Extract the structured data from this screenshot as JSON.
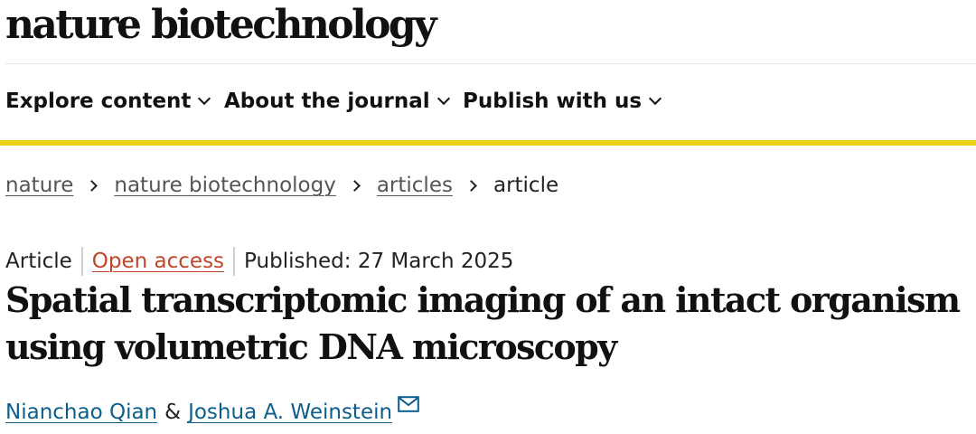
{
  "header": {
    "brand": "nature biotechnology"
  },
  "nav": {
    "items": [
      {
        "label": "Explore content",
        "icon": "chevron-down-icon"
      },
      {
        "label": "About the journal",
        "icon": "chevron-down-icon"
      },
      {
        "label": "Publish with us",
        "icon": "chevron-down-icon"
      }
    ],
    "accent_color": "#ebd313"
  },
  "breadcrumb": {
    "items": [
      "nature",
      "nature biotechnology",
      "articles"
    ],
    "current": "article",
    "separator_icon": "chevron-right-icon"
  },
  "article": {
    "type": "Article",
    "access": "Open access",
    "access_color": "#c0462a",
    "published": "Published: 27 March 2025",
    "title": "Spatial transcriptomic imaging of an intact organism using volumetric DNA microscopy",
    "authors": [
      "Nianchao Qian",
      "Joshua A. Weinstein"
    ],
    "author_separator": "&",
    "author_link_color": "#0c5e8c",
    "contact_icon": "mail-icon"
  }
}
